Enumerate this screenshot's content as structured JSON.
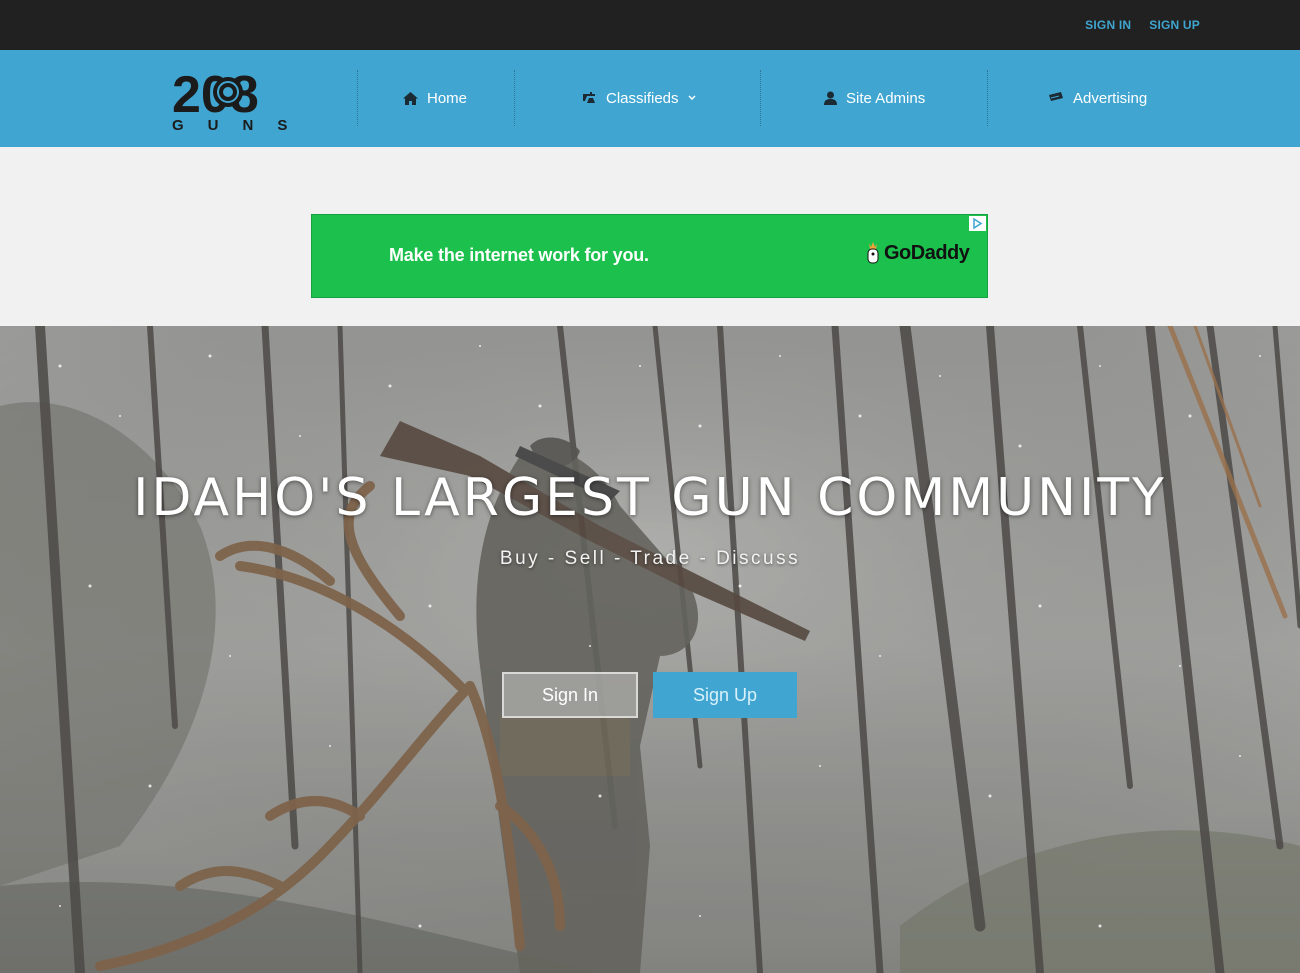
{
  "top_bar": {
    "sign_in": "SIGN IN",
    "sign_up": "SIGN UP"
  },
  "logo": {
    "number": "208",
    "word": "GUNS"
  },
  "nav": {
    "items": [
      {
        "label": "Home",
        "icon": "home-icon"
      },
      {
        "label": "Classifieds",
        "icon": "classifieds-icon",
        "dropdown": true
      },
      {
        "label": "Site Admins",
        "icon": "user-icon"
      },
      {
        "label": "Advertising",
        "icon": "ticket-icon"
      }
    ]
  },
  "ad": {
    "headline": "Make the internet work for you.",
    "brand": "GoDaddy"
  },
  "hero": {
    "title": "IDAHO'S LARGEST GUN COMMUNITY",
    "subtitle": "Buy - Sell - Trade - Discuss",
    "sign_in_button": "Sign In",
    "sign_up_button": "Sign Up"
  },
  "colors": {
    "top_bar": "#222121",
    "nav_bar": "#40a6d1",
    "ad_green": "#1cc14d",
    "link_blue": "#3fa5cf"
  }
}
